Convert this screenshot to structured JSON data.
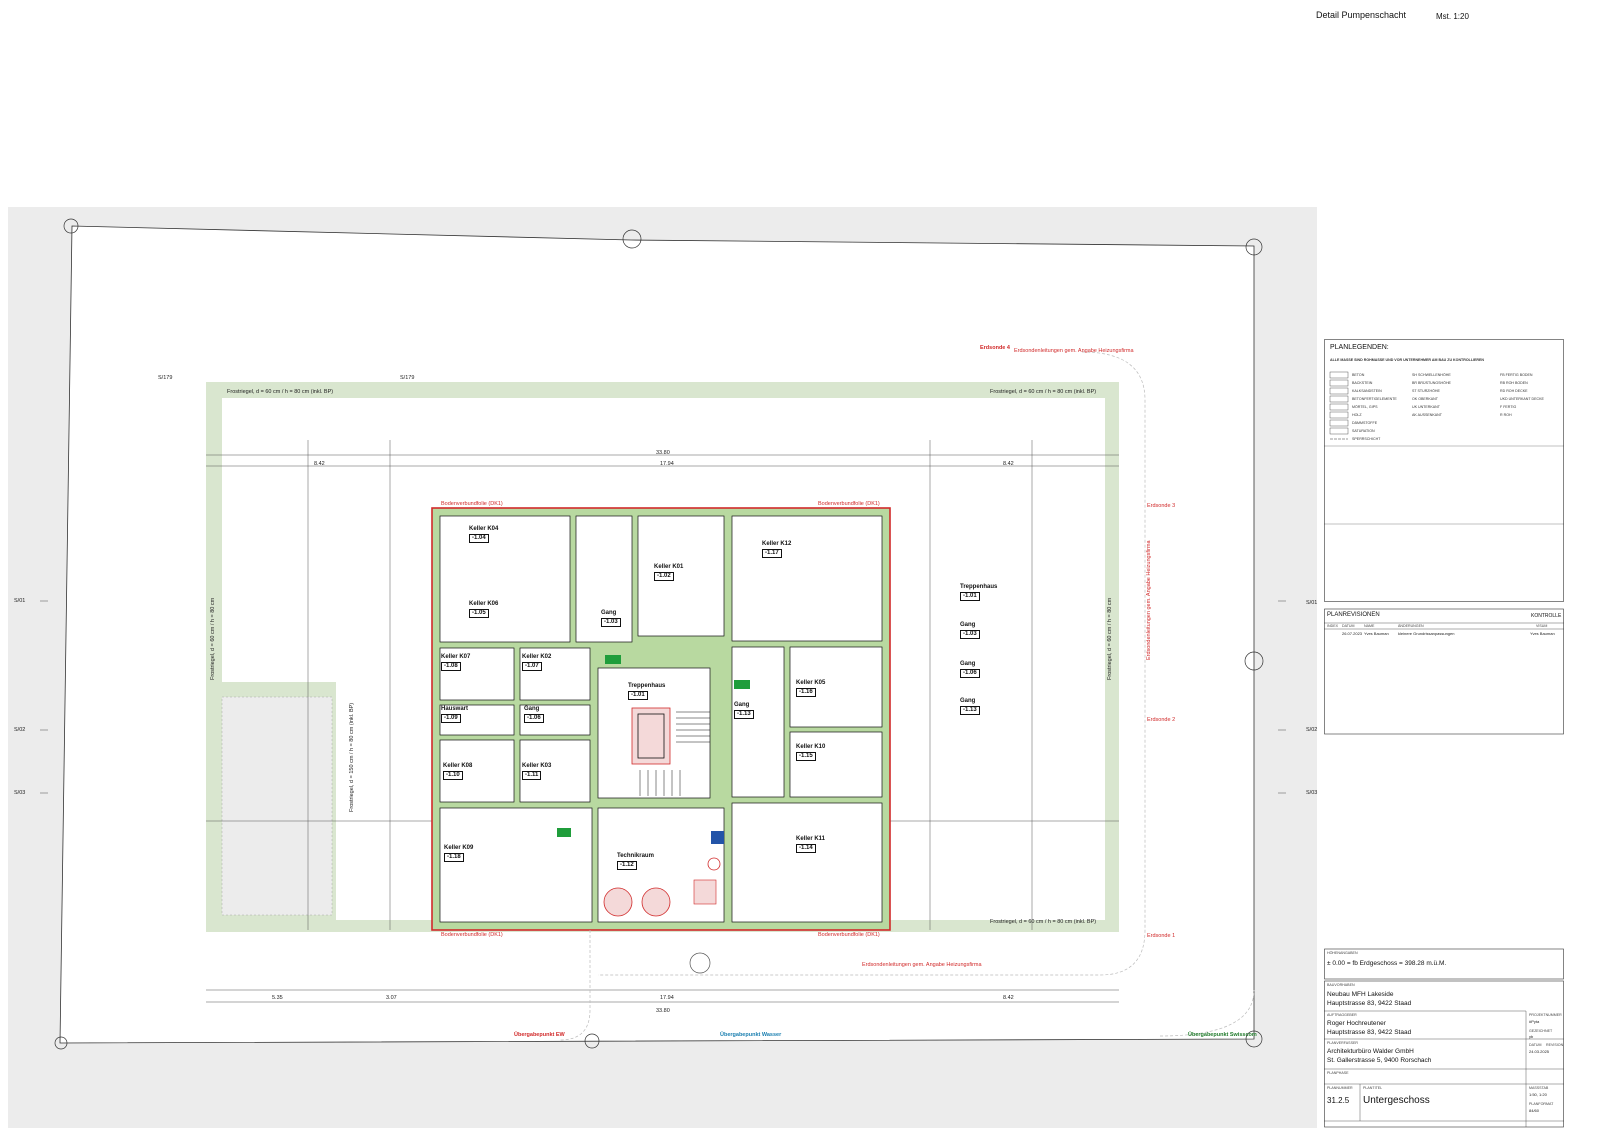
{
  "header": {
    "title": "Detail Pumpenschacht",
    "scale": "Mst. 1:20"
  },
  "grid_axes": {
    "top_left": "S/179",
    "top_mid": "S/179",
    "left": [
      "S/01",
      "S/02",
      "S/03"
    ],
    "right": [
      "S/01",
      "S/02",
      "S/03"
    ]
  },
  "frost_labels": {
    "top_left": "Frostriegel, d = 60 cm / h = 80 cm (inkl. BP)",
    "top_right": "Frostriegel, d = 60 cm / h = 80 cm (inkl. BP)",
    "bottom_right": "Frostriegel, d = 60 cm / h = 80 cm (inkl. BP)",
    "left_outer": "Frostriegel, d = 60 cm / h = 80 cm",
    "left_inner": "Frostriegel, d = 150 cm / h = 80 cm (inkl. BP)",
    "right": "Frostriegel, d = 60 cm / h = 80 cm"
  },
  "bodenverbund_label": "Bodenverbundfolie (DK1)",
  "utility_labels": {
    "erdsonde_4": "Erdsonde 4",
    "erdsonde_3": "Erdsonde 3",
    "erdsonde_2": "Erdsonde 2",
    "erdsonde_1": "Erdsonde 1",
    "top_note": "Erdsondenleitungen gem. Angabe Heizungsfirma",
    "bottom_note": "Erdsondenleitungen gem. Angabe Heizungsfirma",
    "vertical_note": "Erdsondenleitungen gem. Angabe Heizungsfirma",
    "uebergabe_ew": "Übergabepunkt EW",
    "uebergabe_wasser": "Übergabepunkt Wasser",
    "uebergabe_swisscom": "Übergabepunkt Swisscom"
  },
  "dimensions": {
    "total_top": "33.80",
    "seg_left": "8.42",
    "seg_mid": "17.94",
    "seg_right": "8.42",
    "total_bottom": "33.80",
    "b_seg_1": "5.35",
    "b_seg_2": "3.07",
    "b_seg_3": "17.94",
    "b_seg_4": "8.42"
  },
  "rooms": [
    {
      "id": "K04",
      "name": "Keller  K04",
      "level": "-1.04"
    },
    {
      "id": "K01",
      "name": "Keller  K01",
      "level": "-1.02"
    },
    {
      "id": "K12",
      "name": "Keller  K12",
      "level": "-1.17"
    },
    {
      "id": "K06",
      "name": "Keller  K06",
      "level": "-1.05"
    },
    {
      "id": "Gang1",
      "name": "Gang",
      "level": "-1.03"
    },
    {
      "id": "K07",
      "name": "Keller  K07",
      "level": "-1.08"
    },
    {
      "id": "K02",
      "name": "Keller  K02",
      "level": "-1.07"
    },
    {
      "id": "Treppenhaus",
      "name": "Treppenhaus",
      "level": "-1.01"
    },
    {
      "id": "Hauswart",
      "name": "Hauswart",
      "level": "-1.09"
    },
    {
      "id": "Gang2",
      "name": "Gang",
      "level": "-1.06"
    },
    {
      "id": "Gang3",
      "name": "Gang",
      "level": "-1.13"
    },
    {
      "id": "K05",
      "name": "Keller  K05",
      "level": "-1.16"
    },
    {
      "id": "K10",
      "name": "Keller  K10",
      "level": "-1.15"
    },
    {
      "id": "K08",
      "name": "Keller  K08",
      "level": "-1.10"
    },
    {
      "id": "K03",
      "name": "Keller  K03",
      "level": "-1.11"
    },
    {
      "id": "K09",
      "name": "Keller  K09",
      "level": "-1.18"
    },
    {
      "id": "Technikraum",
      "name": "Technikraum",
      "level": "-1.12"
    },
    {
      "id": "K11",
      "name": "Keller  K11",
      "level": "-1.14"
    }
  ],
  "side_list": [
    {
      "name": "Treppenhaus",
      "level": "-1.01"
    },
    {
      "name": "Gang",
      "level": "-1.03"
    },
    {
      "name": "Gang",
      "level": "-1.06"
    },
    {
      "name": "Gang",
      "level": "-1.13"
    }
  ],
  "title_block": {
    "legend_heading": "PLANLEGENDEN:",
    "legend_note": "ALLE MASSE SIND ROHMASSE UND VOR UNTERNEHMER AM BAU ZU KONTROLLIEREN",
    "materials": [
      "BETON",
      "BACKSTEIN",
      "KALKSANDSTEIN",
      "BETONFERTIGELEMENTE",
      "MÖRTEL, GIPS",
      "HOLZ",
      "DÄMMSTOFFE",
      "SATURATION",
      "SPERRSCHICHT"
    ],
    "abbr_1": [
      "SH  SCHWELLENHÖHE",
      "BR  BRÜSTUNGSHÖHE",
      "ST  STURZHÖHE",
      "OK  OBERKANT",
      "UK  UNTERKANT",
      "AK  AUSSENKANT"
    ],
    "abbr_2": [
      "FB  FERTIG BODEN",
      "RB  ROH BODEN",
      "RD  ROH DECKE",
      "UKD  UNTERKANT DECKE",
      "F  FERTIG",
      "R  ROH"
    ],
    "revisions_heading": "PLANREVISIONEN",
    "kontrolle": "KONTROLLE",
    "rev_cols": [
      "INDEX",
      "DATUM",
      "NAME",
      "ÄNDERUNGEN"
    ],
    "rev_row": [
      "",
      "26.07.2023",
      "Yves Bauman",
      "kleinere Grundrissanpassungen"
    ],
    "visum_heading": "VISUM",
    "visum_value": "Yves Bauman",
    "hoehe_label": "HÖHENANGABEN",
    "hoehe_value": "± 0.00 = fb Erdgeschoss = 398.28 m.ü.M.",
    "bauvorhaben_label": "BAUVORHABEN",
    "bauvorhaben_1": "Neubau MFH Lakeside",
    "bauvorhaben_2": "Hauptstrasse 83, 9422 Staad",
    "bauherr_label": "AUFTRAGGEBER",
    "bauherr_1": "Roger Hochreutener",
    "bauherr_2": "Hauptstrasse 83, 9422 Staad",
    "architekt_label": "PLANVERFASSER",
    "architekt_1": "Architekturbüro Walder GmbH",
    "architekt_2": "St. Gallerstrasse 5, 9400 Rorschach",
    "projnr_label": "PROJEKTNUMMER",
    "projnr": "#Pyta",
    "gez_label": "GEZEICHNET",
    "gez": "yb",
    "datum_label": "DATUM",
    "datum": "24.03.2025",
    "revision_label": "REVISION",
    "planphase_label": "PLANPHASE",
    "plannr_label": "PLANNUMMER",
    "plannr": "31.2.5",
    "plantitel_label": "PLANTITEL",
    "plantitel": "Untergeschoss",
    "massstab_label": "MASSSTAB",
    "massstab": "1:50, 1:20",
    "format_label": "PLANFORMAT",
    "format": "84/60"
  },
  "colors": {
    "frost_band": "#d9e6cf",
    "wall_green": "#b8d9a0",
    "outline_red": "#d12a2a",
    "gray_bg": "#ececec"
  }
}
